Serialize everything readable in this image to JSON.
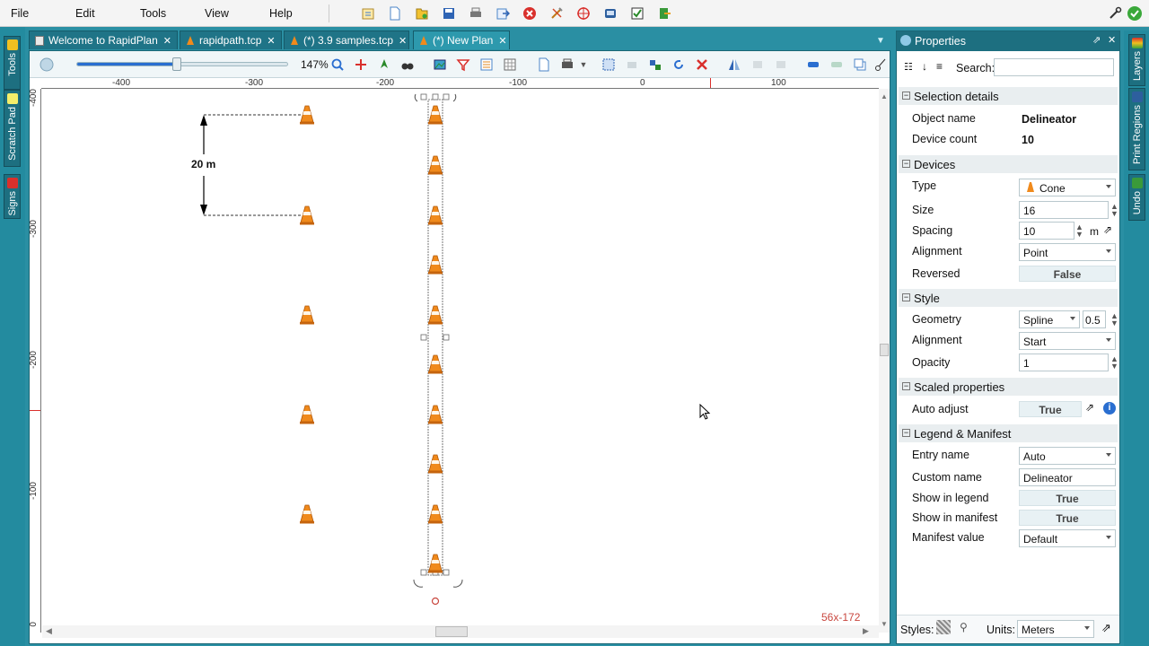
{
  "menu": {
    "file": "File",
    "edit": "Edit",
    "tools": "Tools",
    "view": "View",
    "help": "Help"
  },
  "left_panels": {
    "tools": "Tools",
    "scratch_pad": "Scratch Pad",
    "signs": "Signs"
  },
  "right_panels": {
    "layers": "Layers",
    "print_regions": "Print Regions",
    "undo": "Undo"
  },
  "tabs": [
    {
      "label": "Welcome to RapidPlan",
      "close": "✕"
    },
    {
      "label": "rapidpath.tcp",
      "close": "✕"
    },
    {
      "label": "(*) 3.9 samples.tcp",
      "close": "✕"
    },
    {
      "label": "(*) New Plan",
      "close": "✕"
    }
  ],
  "editor": {
    "zoom": "147%",
    "zoom_fraction": 0.47,
    "ruler_h": [
      "-400",
      "-300",
      "-200",
      "-100",
      "0",
      "100"
    ],
    "ruler_v": [
      "-400",
      "-300",
      "-200",
      "-100",
      "0"
    ],
    "dimension_label": "20 m",
    "coords": "56x-172"
  },
  "properties": {
    "title": "Properties",
    "search_label": "Search:",
    "search_value": "",
    "sections": {
      "selection": "Selection details",
      "devices": "Devices",
      "style": "Style",
      "scaled": "Scaled properties",
      "legend": "Legend & Manifest"
    },
    "object_name_label": "Object name",
    "object_name": "Delineator",
    "device_count_label": "Device count",
    "device_count": "10",
    "type_label": "Type",
    "type": "Cone",
    "size_label": "Size",
    "size": "16",
    "spacing_label": "Spacing",
    "spacing": "10",
    "spacing_unit": "m",
    "alignment_label": "Alignment",
    "alignment": "Point",
    "reversed_label": "Reversed",
    "reversed": "False",
    "geometry_label": "Geometry",
    "geometry": "Spline",
    "geometry_tension": "0.5",
    "style_alignment_label": "Alignment",
    "style_alignment": "Start",
    "opacity_label": "Opacity",
    "opacity": "1",
    "auto_adjust_label": "Auto adjust",
    "auto_adjust": "True",
    "entry_name_label": "Entry name",
    "entry_name": "Auto",
    "custom_name_label": "Custom name",
    "custom_name": "Delineator",
    "show_legend_label": "Show in legend",
    "show_legend": "True",
    "show_manifest_label": "Show in manifest",
    "show_manifest": "True",
    "manifest_value_label": "Manifest value",
    "manifest_value": "Default",
    "styles_label": "Styles:",
    "units_label": "Units:",
    "units": "Meters"
  },
  "colors": {
    "accent": "#2a8fa3",
    "panel_header": "#1d6f80",
    "cone": "#f08a1c",
    "coords": "#c9473f"
  }
}
